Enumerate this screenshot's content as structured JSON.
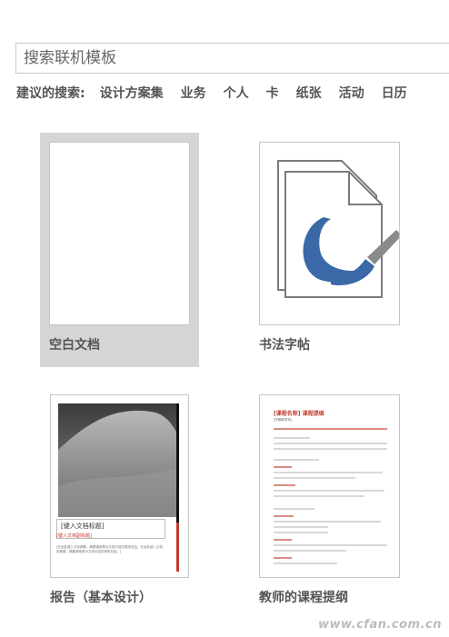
{
  "search": {
    "placeholder": "搜索联机模板"
  },
  "suggested": {
    "lead": "建议的搜索:",
    "links": [
      "设计方案集",
      "业务",
      "个人",
      "卡",
      "纸张",
      "活动",
      "日历"
    ]
  },
  "templates": [
    {
      "label": "空白文档"
    },
    {
      "label": "书法字帖"
    },
    {
      "label": "报告（基本设计）",
      "preview_title": "[键入文档标题]",
      "preview_subtitle": "[键入文档副标题]",
      "preview_text": "[在此处键入文档摘要。摘要通常是对文档内容的简短总结。在此处键入文档的摘要。摘要通常是对文档内容的简短总结。]"
    },
    {
      "label": "教师的课程提纲",
      "preview_title": "[课程名称] 课程提纲",
      "preview_subtitle": "[学期和学年]"
    }
  ],
  "colors": {
    "selected_bg": "#d5d5d5",
    "accent_red": "#c0392b",
    "brush_blue": "#3b69a8"
  },
  "watermark": "www.cfan.com.cn"
}
